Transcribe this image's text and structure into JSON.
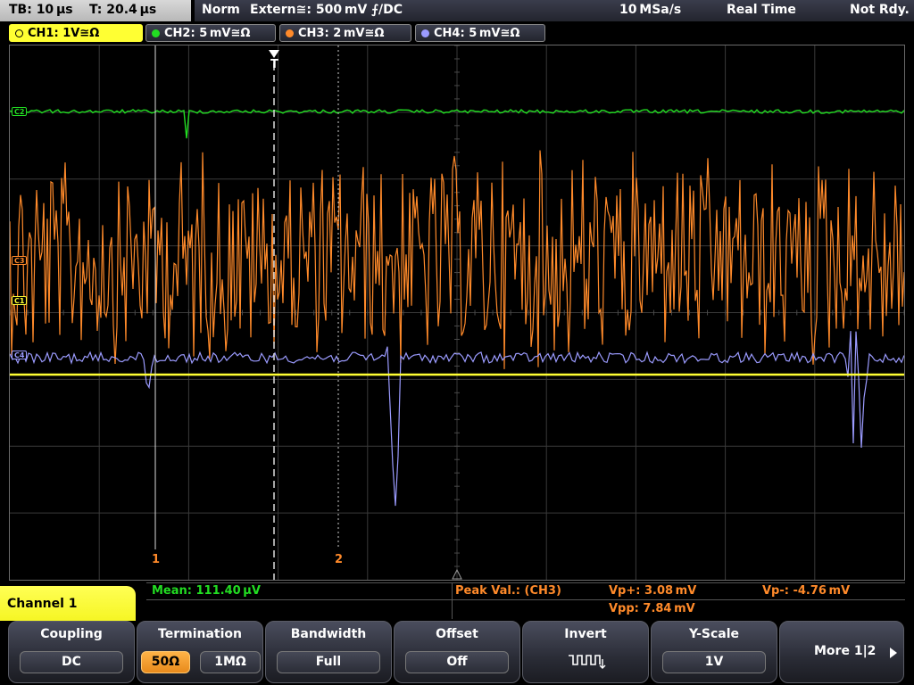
{
  "topbar": {
    "tb_label": "TB: 10 µs",
    "t_label": "T: 20.4 µs",
    "mode": "Norm",
    "trigger": "Extern≅: 500 mV ⨍/DC",
    "sample_rate": "10 MSa/s",
    "acq_mode": "Real Time",
    "state": "Not Rdy."
  },
  "tabs": [
    {
      "label": "CH1: 1V≅Ω",
      "color": "#ffff33"
    },
    {
      "label": "CH2: 5 mV≅Ω",
      "color": "#22dd22"
    },
    {
      "label": "CH3: 2 mV≅Ω",
      "color": "#ff8a2a"
    },
    {
      "label": "CH4: 5 mV≅Ω",
      "color": "#9b9bff"
    }
  ],
  "markers": {
    "ch1": "C1",
    "ch2": "C2",
    "ch3": "C3",
    "ch4": "C4",
    "trigger": "T",
    "cursor1": "1",
    "cursor2": "2"
  },
  "measurement": {
    "mean": "Mean: 111.40 µV",
    "peak_label": "Peak Val.:  (CH3)",
    "vp_plus": "Vp+: 3.08 mV",
    "vpp": "Vpp: 7.84 mV",
    "vp_minus": "Vp-: -4.76 mV"
  },
  "menu": {
    "title": "Channel 1"
  },
  "softkeys": {
    "coupling": {
      "label": "Coupling",
      "value": "DC"
    },
    "termination": {
      "label": "Termination",
      "opt1": "50Ω",
      "opt2": "1MΩ"
    },
    "bandwidth": {
      "label": "Bandwidth",
      "value": "Full"
    },
    "offset": {
      "label": "Offset",
      "value": "Off"
    },
    "invert": {
      "label": "Invert"
    },
    "yscale": {
      "label": "Y-Scale",
      "value": "1V"
    },
    "more": {
      "label": "More 1|2"
    }
  },
  "colors": {
    "ch1": "#ffff33",
    "ch2": "#22dd22",
    "ch3": "#ff8a2a",
    "ch4": "#9b9bff",
    "cursor": "#ff8a2a"
  }
}
